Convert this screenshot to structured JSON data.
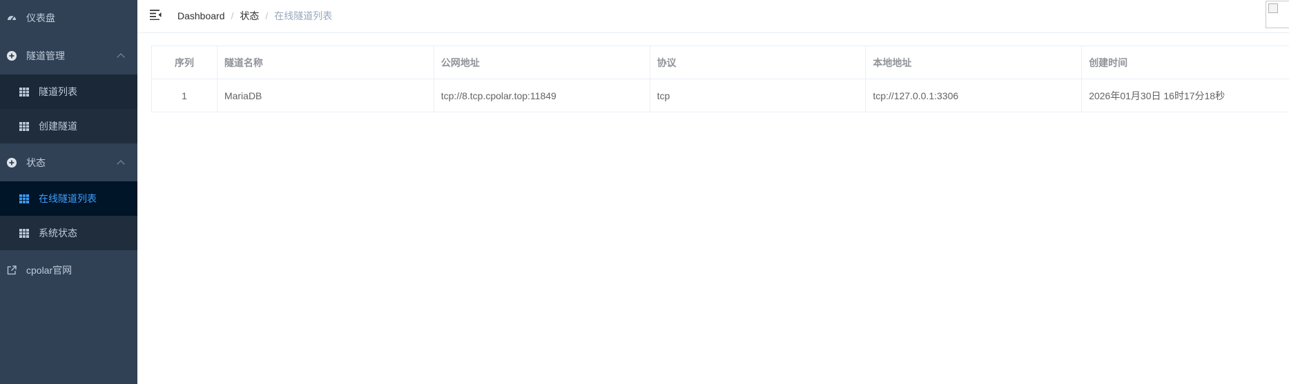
{
  "sidebar": {
    "dashboard": {
      "label": "仪表盘",
      "icon": "dashboard-icon"
    },
    "tunnel_mgmt": {
      "label": "隧道管理",
      "icon": "plus-circle-icon",
      "items": [
        {
          "label": "隧道列表",
          "icon": "table-grid-icon"
        },
        {
          "label": "创建隧道",
          "icon": "table-grid-icon"
        }
      ]
    },
    "status": {
      "label": "状态",
      "icon": "plus-circle-icon",
      "items": [
        {
          "label": "在线隧道列表",
          "icon": "table-grid-icon",
          "active": true
        },
        {
          "label": "系统状态",
          "icon": "table-grid-icon"
        }
      ]
    },
    "external": {
      "label": "cpolar官网",
      "icon": "external-link-icon"
    },
    "colors": {
      "bg": "#304156",
      "submenu_bg": "#1f2d3d",
      "active_text": "#409eff"
    }
  },
  "header": {
    "breadcrumb": [
      "Dashboard",
      "状态",
      "在线隧道列表"
    ]
  },
  "table": {
    "columns": [
      "序列",
      "隧道名称",
      "公网地址",
      "协议",
      "本地地址",
      "创建时间"
    ],
    "rows": [
      [
        "1",
        "MariaDB",
        "tcp://8.tcp.cpolar.top:11849",
        "tcp",
        "tcp://127.0.0.1:3306",
        "2026年01月30日 16时17分18秒"
      ]
    ]
  }
}
